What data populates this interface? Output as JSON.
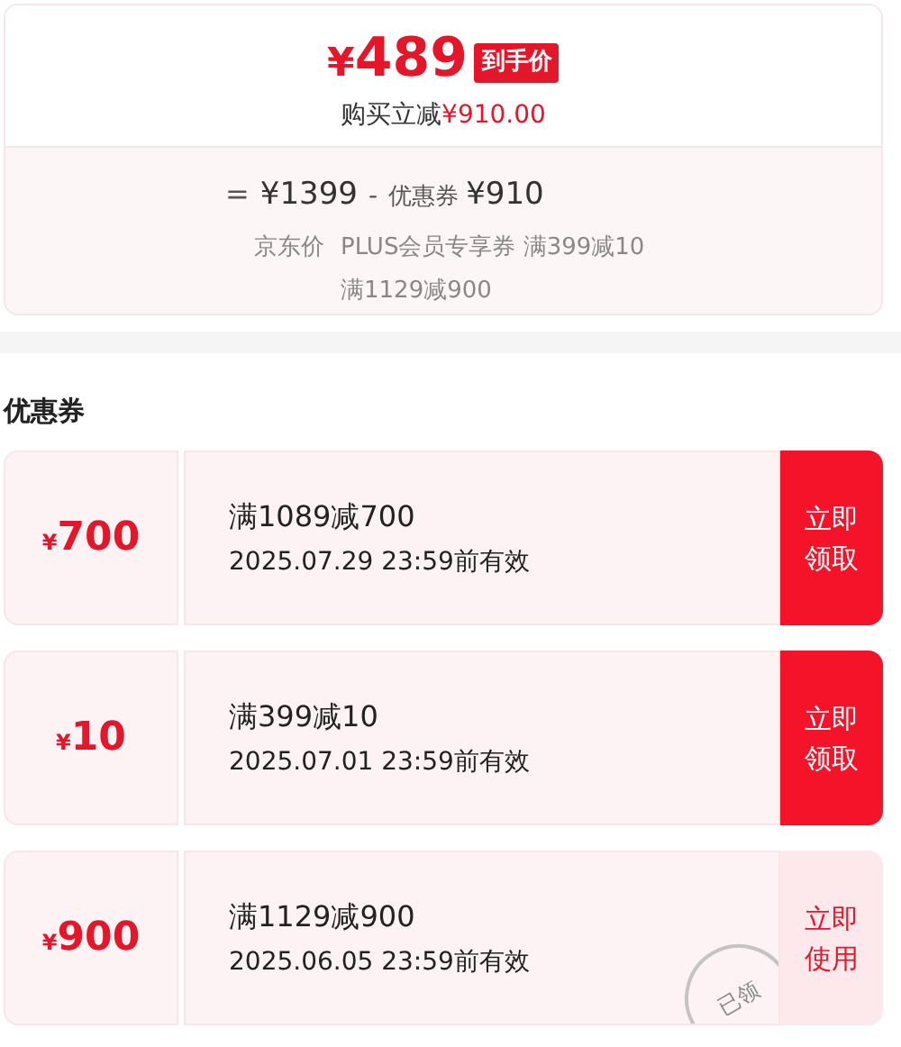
{
  "price_card": {
    "currency": "¥",
    "price": "489",
    "badge": "到手价",
    "saving_label": "购买立减",
    "saving_amount": "¥910.00",
    "breakdown": {
      "equals": "=",
      "base_price": "¥1399",
      "minus": "-",
      "coupon_label": "优惠券",
      "coupon_amount": "¥910",
      "base_caption": "京东价",
      "coupon_lines": [
        "PLUS会员专享券 满399减10",
        "满1129减900"
      ]
    }
  },
  "coupons_section": {
    "title": "优惠券",
    "coupons": [
      {
        "currency": "¥",
        "amount": "700",
        "condition": "满1089减700",
        "validity": "2025.07.29 23:59前有效",
        "action": "立即领取",
        "claimed": false
      },
      {
        "currency": "¥",
        "amount": "10",
        "condition": "满399减10",
        "validity": "2025.07.01 23:59前有效",
        "action": "立即领取",
        "claimed": false
      },
      {
        "currency": "¥",
        "amount": "900",
        "condition": "满1129减900",
        "validity": "2025.06.05 23:59前有效",
        "action": "立即使用",
        "claimed": true,
        "stamp": "已领"
      }
    ]
  }
}
